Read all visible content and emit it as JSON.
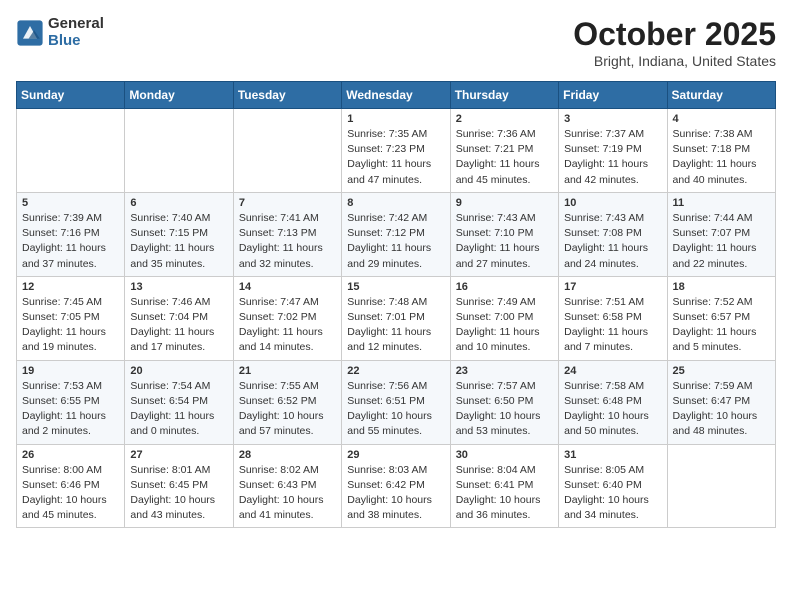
{
  "logo": {
    "general": "General",
    "blue": "Blue"
  },
  "title": "October 2025",
  "location": "Bright, Indiana, United States",
  "weekdays": [
    "Sunday",
    "Monday",
    "Tuesday",
    "Wednesday",
    "Thursday",
    "Friday",
    "Saturday"
  ],
  "weeks": [
    [
      {
        "day": "",
        "info": ""
      },
      {
        "day": "",
        "info": ""
      },
      {
        "day": "",
        "info": ""
      },
      {
        "day": "1",
        "info": "Sunrise: 7:35 AM\nSunset: 7:23 PM\nDaylight: 11 hours\nand 47 minutes."
      },
      {
        "day": "2",
        "info": "Sunrise: 7:36 AM\nSunset: 7:21 PM\nDaylight: 11 hours\nand 45 minutes."
      },
      {
        "day": "3",
        "info": "Sunrise: 7:37 AM\nSunset: 7:19 PM\nDaylight: 11 hours\nand 42 minutes."
      },
      {
        "day": "4",
        "info": "Sunrise: 7:38 AM\nSunset: 7:18 PM\nDaylight: 11 hours\nand 40 minutes."
      }
    ],
    [
      {
        "day": "5",
        "info": "Sunrise: 7:39 AM\nSunset: 7:16 PM\nDaylight: 11 hours\nand 37 minutes."
      },
      {
        "day": "6",
        "info": "Sunrise: 7:40 AM\nSunset: 7:15 PM\nDaylight: 11 hours\nand 35 minutes."
      },
      {
        "day": "7",
        "info": "Sunrise: 7:41 AM\nSunset: 7:13 PM\nDaylight: 11 hours\nand 32 minutes."
      },
      {
        "day": "8",
        "info": "Sunrise: 7:42 AM\nSunset: 7:12 PM\nDaylight: 11 hours\nand 29 minutes."
      },
      {
        "day": "9",
        "info": "Sunrise: 7:43 AM\nSunset: 7:10 PM\nDaylight: 11 hours\nand 27 minutes."
      },
      {
        "day": "10",
        "info": "Sunrise: 7:43 AM\nSunset: 7:08 PM\nDaylight: 11 hours\nand 24 minutes."
      },
      {
        "day": "11",
        "info": "Sunrise: 7:44 AM\nSunset: 7:07 PM\nDaylight: 11 hours\nand 22 minutes."
      }
    ],
    [
      {
        "day": "12",
        "info": "Sunrise: 7:45 AM\nSunset: 7:05 PM\nDaylight: 11 hours\nand 19 minutes."
      },
      {
        "day": "13",
        "info": "Sunrise: 7:46 AM\nSunset: 7:04 PM\nDaylight: 11 hours\nand 17 minutes."
      },
      {
        "day": "14",
        "info": "Sunrise: 7:47 AM\nSunset: 7:02 PM\nDaylight: 11 hours\nand 14 minutes."
      },
      {
        "day": "15",
        "info": "Sunrise: 7:48 AM\nSunset: 7:01 PM\nDaylight: 11 hours\nand 12 minutes."
      },
      {
        "day": "16",
        "info": "Sunrise: 7:49 AM\nSunset: 7:00 PM\nDaylight: 11 hours\nand 10 minutes."
      },
      {
        "day": "17",
        "info": "Sunrise: 7:51 AM\nSunset: 6:58 PM\nDaylight: 11 hours\nand 7 minutes."
      },
      {
        "day": "18",
        "info": "Sunrise: 7:52 AM\nSunset: 6:57 PM\nDaylight: 11 hours\nand 5 minutes."
      }
    ],
    [
      {
        "day": "19",
        "info": "Sunrise: 7:53 AM\nSunset: 6:55 PM\nDaylight: 11 hours\nand 2 minutes."
      },
      {
        "day": "20",
        "info": "Sunrise: 7:54 AM\nSunset: 6:54 PM\nDaylight: 11 hours\nand 0 minutes."
      },
      {
        "day": "21",
        "info": "Sunrise: 7:55 AM\nSunset: 6:52 PM\nDaylight: 10 hours\nand 57 minutes."
      },
      {
        "day": "22",
        "info": "Sunrise: 7:56 AM\nSunset: 6:51 PM\nDaylight: 10 hours\nand 55 minutes."
      },
      {
        "day": "23",
        "info": "Sunrise: 7:57 AM\nSunset: 6:50 PM\nDaylight: 10 hours\nand 53 minutes."
      },
      {
        "day": "24",
        "info": "Sunrise: 7:58 AM\nSunset: 6:48 PM\nDaylight: 10 hours\nand 50 minutes."
      },
      {
        "day": "25",
        "info": "Sunrise: 7:59 AM\nSunset: 6:47 PM\nDaylight: 10 hours\nand 48 minutes."
      }
    ],
    [
      {
        "day": "26",
        "info": "Sunrise: 8:00 AM\nSunset: 6:46 PM\nDaylight: 10 hours\nand 45 minutes."
      },
      {
        "day": "27",
        "info": "Sunrise: 8:01 AM\nSunset: 6:45 PM\nDaylight: 10 hours\nand 43 minutes."
      },
      {
        "day": "28",
        "info": "Sunrise: 8:02 AM\nSunset: 6:43 PM\nDaylight: 10 hours\nand 41 minutes."
      },
      {
        "day": "29",
        "info": "Sunrise: 8:03 AM\nSunset: 6:42 PM\nDaylight: 10 hours\nand 38 minutes."
      },
      {
        "day": "30",
        "info": "Sunrise: 8:04 AM\nSunset: 6:41 PM\nDaylight: 10 hours\nand 36 minutes."
      },
      {
        "day": "31",
        "info": "Sunrise: 8:05 AM\nSunset: 6:40 PM\nDaylight: 10 hours\nand 34 minutes."
      },
      {
        "day": "",
        "info": ""
      }
    ]
  ]
}
